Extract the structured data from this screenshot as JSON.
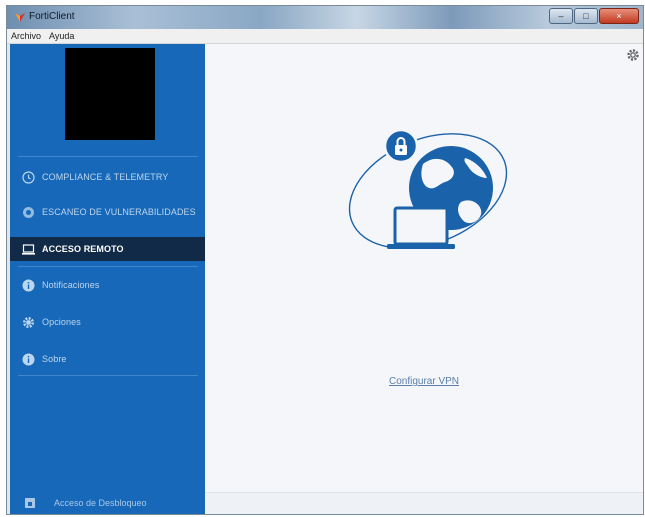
{
  "window": {
    "title": "FortiClient",
    "controls": {
      "minimize": "–",
      "maximize": "□",
      "close": "×"
    }
  },
  "menu": {
    "items": [
      "Archivo",
      "Ayuda"
    ]
  },
  "sidebar": {
    "items": [
      {
        "label": "COMPLIANCE & TELEMETRY",
        "icon": "shield-check-icon",
        "active": false
      },
      {
        "label": "ESCANEO DE VULNERABILIDADES",
        "icon": "scan-icon",
        "active": false
      },
      {
        "label": "ACCESO REMOTO",
        "icon": "laptop-icon",
        "active": true
      },
      {
        "label": "Notificaciones",
        "icon": "info-icon",
        "active": false
      },
      {
        "label": "Opciones",
        "icon": "gear-icon",
        "active": false
      },
      {
        "label": "Sobre",
        "icon": "about-icon",
        "active": false
      }
    ],
    "footer": "Acceso de Desbloqueo"
  },
  "main": {
    "link": "Configurar VPN"
  },
  "colors": {
    "sidebar": "#1768b8",
    "active_item": "#102a47",
    "accent": "#1a62aa",
    "link": "#5b7fa8",
    "main_bg": "#f4f6f9"
  }
}
